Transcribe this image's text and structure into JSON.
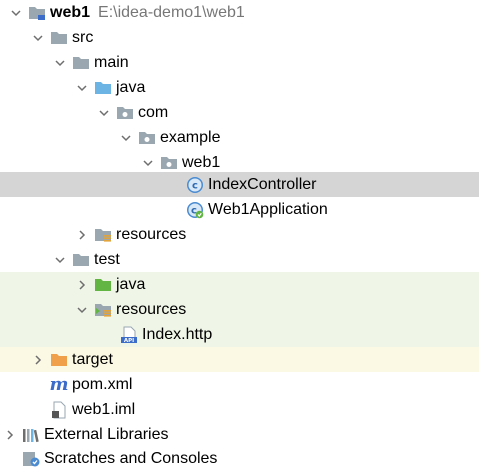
{
  "tree": {
    "root": {
      "label": "web1",
      "path": "E:\\idea-demo1\\web1"
    },
    "src": "src",
    "main": "main",
    "java": "java",
    "com": "com",
    "example": "example",
    "web1_pkg": "web1",
    "index_controller": "IndexController",
    "web1_application": "Web1Application",
    "resources_main": "resources",
    "test": "test",
    "test_java": "java",
    "test_resources": "resources",
    "index_http": "Index.http",
    "target": "target",
    "pom": "pom.xml",
    "iml": "web1.iml",
    "external_libraries": "External Libraries",
    "scratches": "Scratches and Consoles"
  },
  "colors": {
    "folder_gray": "#9aa7b0",
    "source_root_blue": "#6bb4e3",
    "test_root_green": "#62b543",
    "excluded_orange": "#f0a04b",
    "class_icon": "#4a8bd1",
    "selection": "#d5d5d5",
    "test_highlight": "#eff6e8",
    "excluded_highlight": "#fbf8e3"
  },
  "icons": {
    "collapse": "chevron-down-icon",
    "expand": "chevron-right-icon"
  }
}
